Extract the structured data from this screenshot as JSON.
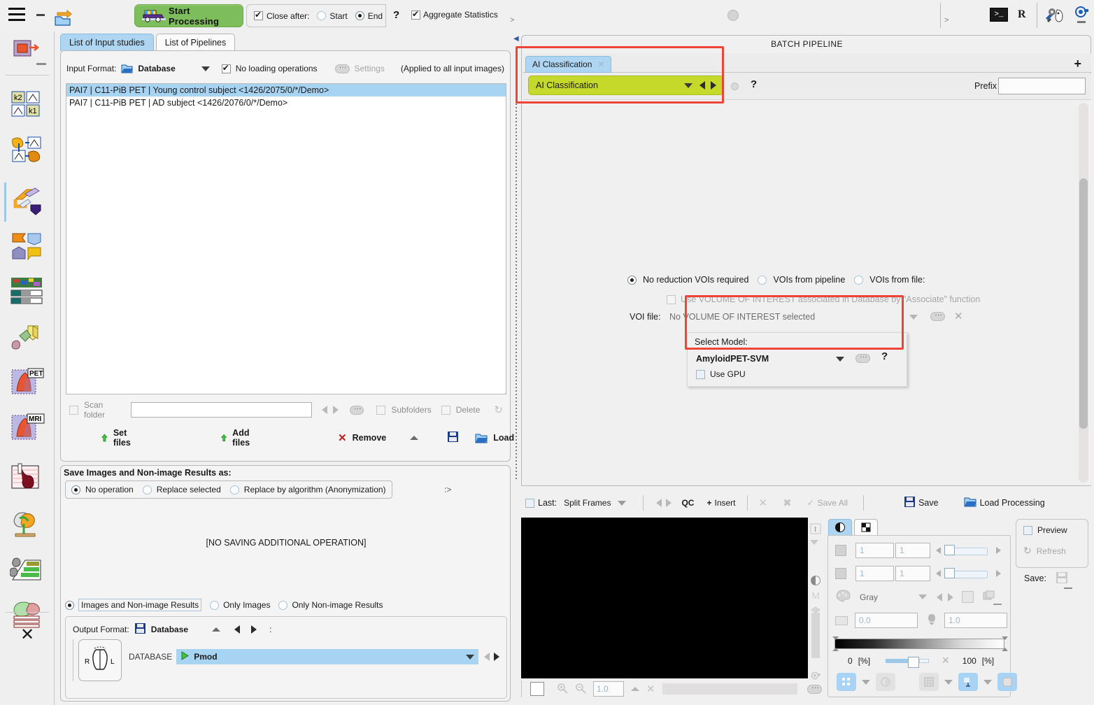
{
  "toolbar": {
    "start_processing": "Start Processing",
    "close_after": "Close after:",
    "start": "Start",
    "end": "End",
    "help": "?",
    "aggregate_statistics": "Aggregate Statistics",
    "chevron": ">",
    "chevron2": ">",
    "terminal": ">_",
    "r_label": "R"
  },
  "tabs": {
    "input_studies": "List of Input studies",
    "pipelines": "List of Pipelines"
  },
  "input": {
    "format_label": "Input Format:",
    "format_value": "Database",
    "no_loading_operations": "No loading operations",
    "settings": "Settings",
    "applied_note": "(Applied to all input images)",
    "studies": [
      "PAI7 | C11-PiB PET | Young control subject <1426/2075/0/*/Demo>",
      "PAI7 | C11-PiB PET | AD subject <1426/2076/0/*/Demo>"
    ],
    "scan_folder": "Scan folder",
    "scan_value": "",
    "subfolders": "Subfolders",
    "delete": "Delete",
    "set_files": "Set files",
    "add_files": "Add files",
    "remove": "Remove",
    "load": "Load"
  },
  "save_section": {
    "title": "Save Images and Non-image Results  as:",
    "options": [
      "No operation",
      "Replace selected",
      "Replace by algorithm (Anonymization)"
    ],
    "selected": 0,
    "chevron": ":>",
    "no_saving_note": "[NO SAVING ADDITIONAL OPERATION]",
    "result_options": [
      "Images and Non-image Results",
      "Only Images",
      "Only Non-image Results"
    ],
    "result_selected": 0,
    "output_format_label": "Output Format:",
    "output_format_value": "Database",
    "colon": ":",
    "database_label": "DATABASE",
    "database_value": "Pmod",
    "thumb_left": "R",
    "thumb_right": "L"
  },
  "pipeline": {
    "title": "BATCH PIPELINE",
    "tab_label": "AI Classification",
    "tab_close": "✕",
    "add": "+",
    "module_name": "AI Classification",
    "module_help": "?",
    "prefix_label": "Prefix",
    "prefix_value": "",
    "voi_options": [
      "No reduction VOIs required",
      "VOIs from pipeline",
      "VOIs from file:"
    ],
    "voi_selected": 0,
    "assoc_checkbox": "Use VOLUME OF INTEREST associated in Database by \"Associate\" function",
    "voi_file_label": "VOI file:",
    "voi_file_value": "No VOLUME OF INTEREST selected",
    "select_model_label": "Select Model:",
    "model_value": "AmyloidPET-SVM",
    "model_help": "?",
    "use_gpu": "Use GPU"
  },
  "bottombar": {
    "last": "Last:",
    "split_frames": "Split Frames",
    "qc": "QC",
    "insert": "Insert",
    "insert_plus": "+",
    "save_all": "Save All",
    "save": "Save",
    "load_processing": "Load Processing"
  },
  "controls": {
    "slice_a": "1",
    "slice_b": "1",
    "frame_a": "1",
    "frame_b": "1",
    "colortable": "Gray",
    "min_value": "0.0",
    "max_value": "1.0",
    "pct_low": "0",
    "pct_low_unit": "[%]",
    "pct_high": "100",
    "pct_high_unit": "[%]",
    "preview": "Preview",
    "refresh": "Refresh",
    "save_label": "Save:",
    "zoom_value": "1.0"
  },
  "colors": {
    "accent_green": "#7dbd5c",
    "module_green": "#c5d92a",
    "selection_blue": "#a8d4f4",
    "tab_blue": "#aed6f2",
    "highlight_red": "#f04438",
    "panel_bg": "#f0f0f0"
  },
  "rail_icons": [
    "pixelwise-modeling-icon",
    "kinetic-k2k1-icon",
    "kinetic-model-icon",
    "pipeline-icon",
    "fusion-icon",
    "segmentation-icon",
    "geometry-icon",
    "pet-cardiac-icon",
    "mri-cardiac-icon",
    "perfusion-icon",
    "brain-icon",
    "projection-icon",
    "slices-icon",
    "close-icon"
  ]
}
